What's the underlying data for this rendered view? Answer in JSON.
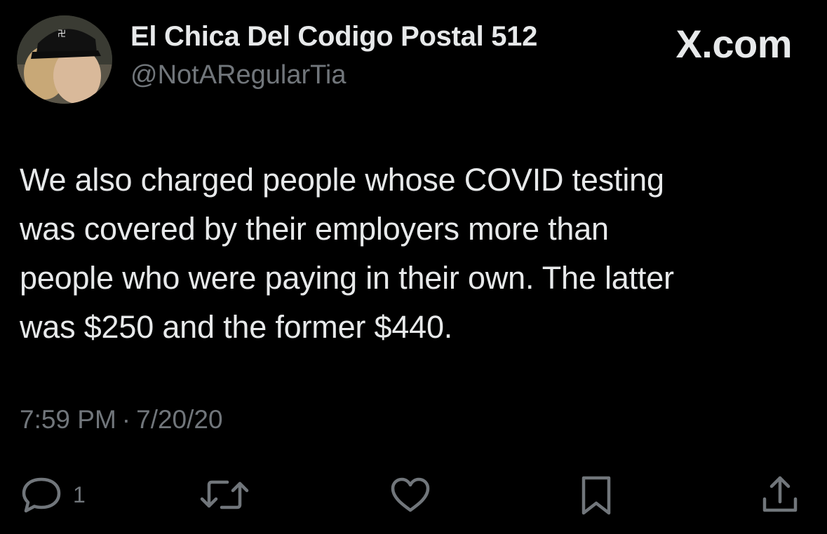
{
  "author": {
    "display_name": "El Chica Del Codigo Postal 512",
    "handle": "@NotARegularTia"
  },
  "brand": "X.com",
  "tweet": {
    "lines": [
      "We also charged people whose COVID testing",
      "was covered by their employers more than",
      "people who were paying in their own. The latter",
      "was $250 and the former $440."
    ],
    "time": "7:59 PM",
    "separator": "·",
    "date": "7/20/20"
  },
  "actions": {
    "reply_count": "1",
    "icons": [
      "reply-icon",
      "retweet-icon",
      "like-icon",
      "bookmark-icon",
      "share-icon"
    ]
  },
  "colors": {
    "background": "#000000",
    "primary_text": "#e7e9ea",
    "secondary_text": "#71767b"
  }
}
